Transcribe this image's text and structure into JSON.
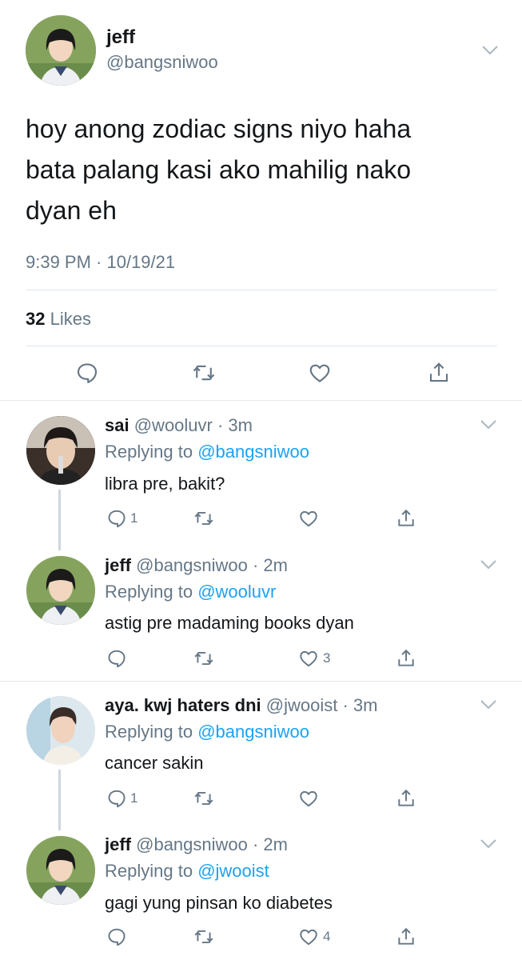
{
  "main_tweet": {
    "author_name": "jeff",
    "handle": "@bangsniwoo",
    "text_line1": "hoy anong zodiac signs niyo haha",
    "text_line2": "bata palang kasi ako mahilig nako",
    "text_line3": "dyan eh",
    "timestamp": "9:39 PM · 10/19/21",
    "likes_count": "32",
    "likes_label": "Likes"
  },
  "replies": [
    {
      "author_name": "sai",
      "handle_time": "@wooluvr · 3m",
      "replying_prefix": "Replying to",
      "replying_to": "@bangsniwoo",
      "text": "libra pre, bakit?",
      "reply_count": "1",
      "like_count": ""
    },
    {
      "author_name": "jeff",
      "handle_time": "@bangsniwoo · 2m",
      "replying_prefix": "Replying to",
      "replying_to": "@wooluvr",
      "text": "astig pre madaming books dyan",
      "reply_count": "",
      "like_count": "3"
    },
    {
      "author_name": "aya. kwj haters dni",
      "handle_time": "@jwooist · 3m",
      "replying_prefix": "Replying to",
      "replying_to": "@bangsniwoo",
      "text": "cancer sakin",
      "reply_count": "1",
      "like_count": ""
    },
    {
      "author_name": "jeff",
      "handle_time": "@bangsniwoo · 2m",
      "replying_prefix": "Replying to",
      "replying_to": "@jwooist",
      "text": "gagi yung pinsan ko diabetes",
      "reply_count": "",
      "like_count": "4"
    }
  ],
  "icons": {
    "reply": "reply-icon",
    "retweet": "retweet-icon",
    "like": "heart-icon",
    "share": "share-icon",
    "more": "chevron-down-icon"
  },
  "colors": {
    "link": "#1da1f2",
    "secondary_text": "#657786",
    "divider": "#e1e8ed",
    "thread_line": "#ccd6dd"
  }
}
